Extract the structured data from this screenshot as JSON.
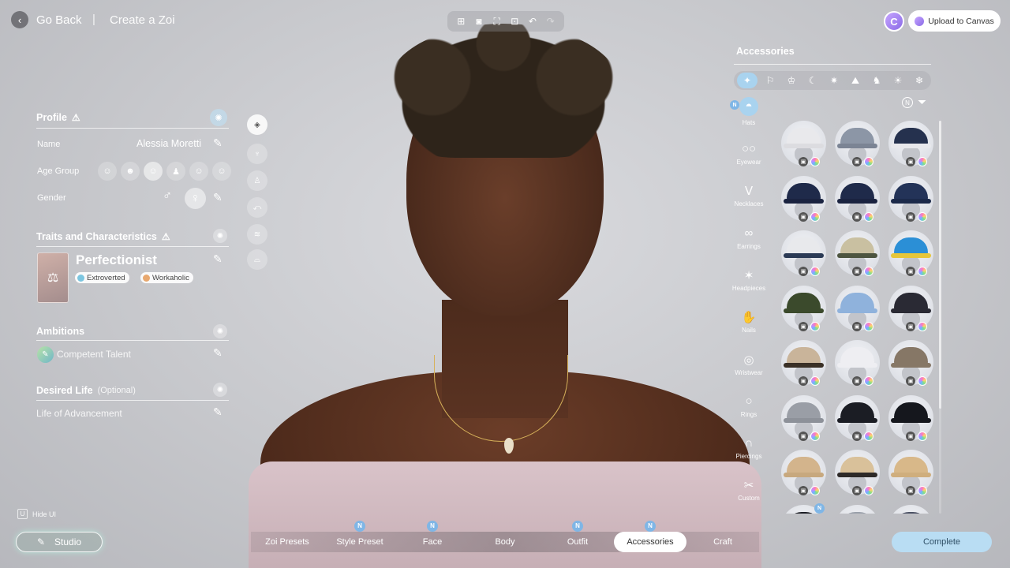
{
  "header": {
    "back_label": "Go Back",
    "separator": "|",
    "title": "Create a Zoi",
    "toolbar": [
      {
        "icon": "add-photo-icon",
        "glyph": "⊞",
        "dim": false
      },
      {
        "icon": "camera-icon",
        "glyph": "◙",
        "dim": false
      },
      {
        "icon": "frame-icon",
        "glyph": "⛶",
        "dim": false
      },
      {
        "icon": "focus-icon",
        "glyph": "⊡",
        "dim": false
      },
      {
        "icon": "undo-icon",
        "glyph": "↶",
        "dim": false
      },
      {
        "icon": "redo-icon",
        "glyph": "↷",
        "dim": true
      }
    ],
    "c_badge": "C",
    "upload_label": "Upload to Canvas"
  },
  "profile": {
    "title": "Profile",
    "name_label": "Name",
    "name_value": "Alessia Moretti",
    "age_label": "Age Group",
    "age_icons": [
      "☺",
      "☻",
      "☺",
      "♟",
      "☺",
      "☺"
    ],
    "age_selected_index": 2,
    "gender_label": "Gender",
    "gender_male": "♂",
    "gender_female": "♀"
  },
  "traits": {
    "title": "Traits and Characteristics",
    "trait_name": "Perfectionist",
    "chip1": "Extroverted",
    "chip2": "Workaholic"
  },
  "ambitions": {
    "title": "Ambitions",
    "value": "Competent Talent"
  },
  "desired_life": {
    "title": "Desired Life",
    "optional": "(Optional)",
    "value": "Life of Advancement"
  },
  "side_slots": [
    "◈",
    "♆",
    "♙",
    "⤺",
    "≋",
    "⌓"
  ],
  "hide_ui": {
    "key": "U",
    "label": "Hide UI"
  },
  "studio_label": "Studio",
  "tabs": [
    {
      "label": "Zoi Presets",
      "new": false,
      "active": false
    },
    {
      "label": "Style Preset",
      "new": true,
      "active": false
    },
    {
      "label": "Face",
      "new": true,
      "active": false
    },
    {
      "label": "Body",
      "new": false,
      "active": false
    },
    {
      "label": "Outfit",
      "new": true,
      "active": false
    },
    {
      "label": "Accessories",
      "new": true,
      "active": true
    },
    {
      "label": "Craft",
      "new": false,
      "active": false
    }
  ],
  "new_badge": "N",
  "complete_label": "Complete",
  "accessories": {
    "title": "Accessories",
    "categories": [
      "✦",
      "⚐",
      "♔",
      "☾",
      "✷",
      "⛰",
      "♞",
      "☀",
      "❄"
    ],
    "selected_category": 0,
    "sub_categories": [
      {
        "label": "Hats",
        "icon": "hat-icon",
        "glyph": "◓"
      },
      {
        "label": "Eyewear",
        "icon": "eyewear-icon",
        "glyph": "○○"
      },
      {
        "label": "Necklaces",
        "icon": "necklace-icon",
        "glyph": "ᐯ"
      },
      {
        "label": "Earrings",
        "icon": "earring-icon",
        "glyph": "∞"
      },
      {
        "label": "Headpieces",
        "icon": "headpiece-icon",
        "glyph": "✶"
      },
      {
        "label": "Nails",
        "icon": "nails-icon",
        "glyph": "✋"
      },
      {
        "label": "Wristwear",
        "icon": "wristwear-icon",
        "glyph": "◎"
      },
      {
        "label": "Rings",
        "icon": "ring-icon",
        "glyph": "○"
      },
      {
        "label": "Piercings",
        "icon": "piercing-icon",
        "glyph": "∩"
      },
      {
        "label": "Custom",
        "icon": "custom-icon",
        "glyph": "✂"
      }
    ],
    "filter_n": "N",
    "filter_glyph": "⏷",
    "hats": [
      {
        "cap": "#e9e9ec",
        "brim": "#dcdce0"
      },
      {
        "cap": "#8c96a6",
        "brim": "#7b8494"
      },
      {
        "cap": "#25314e",
        "brim": "#e8e8ec"
      },
      {
        "cap": "#1f2a4a",
        "brim": "#1a2340"
      },
      {
        "cap": "#1f2a4a",
        "brim": "#1a2340"
      },
      {
        "cap": "#233358",
        "brim": "#1c2a4a"
      },
      {
        "cap": "#e8e9ec",
        "brim": "#2b3a55"
      },
      {
        "cap": "#c9c0a1",
        "brim": "#4d5540"
      },
      {
        "cap": "#2b8fd6",
        "brim": "#e6c63a"
      },
      {
        "cap": "#3b4a2c",
        "brim": "#3b4a2c"
      },
      {
        "cap": "#8fb2dc",
        "brim": "#8fb2dc"
      },
      {
        "cap": "#2a2a34",
        "brim": "#2a2a34"
      },
      {
        "cap": "#c9b49a",
        "brim": "#3a3026"
      },
      {
        "cap": "#eeeef2",
        "brim": "#eeeef2"
      },
      {
        "cap": "#867766",
        "brim": "#867766"
      },
      {
        "cap": "#9a9ea6",
        "brim": "#8d9199"
      },
      {
        "cap": "#1b1d24",
        "brim": "#1b1d24"
      },
      {
        "cap": "#15171d",
        "brim": "#15171d"
      },
      {
        "cap": "#d3b48c",
        "brim": "#c7a87e"
      },
      {
        "cap": "#d9c19a",
        "brim": "#2e2a28"
      },
      {
        "cap": "#d8b889",
        "brim": "#cfae7d"
      },
      {
        "cap": "#1b1d24",
        "brim": "#1b1d24",
        "new": true
      },
      {
        "cap": "#9aa0aa",
        "brim": "#9aa0aa"
      },
      {
        "cap": "#4a5063",
        "brim": "#4a5063"
      }
    ]
  }
}
